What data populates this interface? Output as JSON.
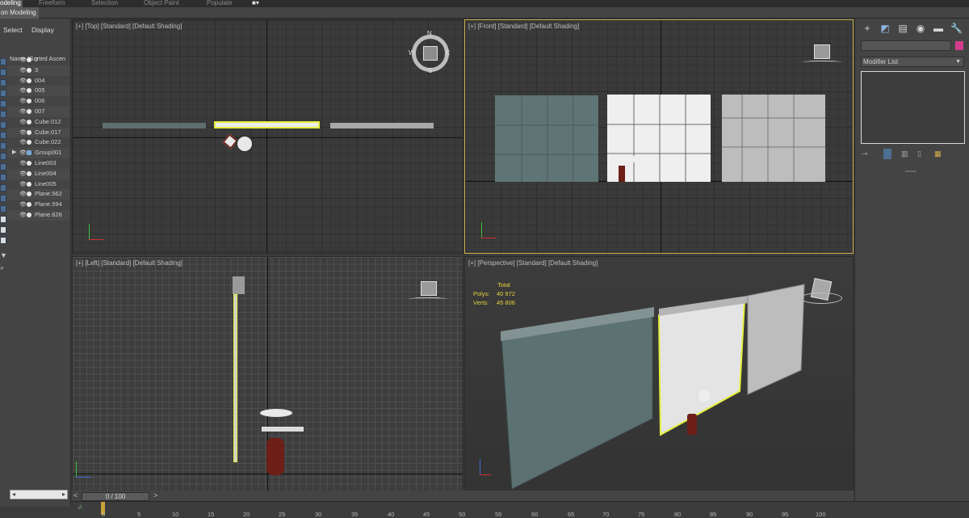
{
  "ribbon": {
    "tabs": [
      "odeling",
      "Freeform",
      "Selection",
      "Object Paint",
      "Populate"
    ],
    "sub_label": "on Modeling"
  },
  "explorer": {
    "select_label": "Select",
    "display_label": "Display",
    "column_header": "Name (Sorted Ascen",
    "items": [
      "2",
      "3",
      "004",
      "005",
      "006",
      "007",
      "Cube.012",
      "Cube.017",
      "Cube.022",
      "Group001",
      "Line003",
      "Line004",
      "Line005",
      "Plane.562",
      "Plane.594",
      "Plane.626"
    ]
  },
  "viewports": {
    "top": "[+] [Top] [Standard] [Default Shading]",
    "front": "[+] [Front] [Standard] [Default Shading]",
    "left": "[+] [Left] [Standard] [Default Shading]",
    "perspective": "[+] [Perspective] [Standard] [Default Shading]"
  },
  "viewcube": {
    "n": "N",
    "s": "S",
    "e": "E",
    "w": "W"
  },
  "stats": {
    "total_label": "Total",
    "polys_label": "Polys:",
    "polys_value": "40 972",
    "verts_label": "Verts:",
    "verts_value": "45 806"
  },
  "command_panel": {
    "modifier_list_label": "Modifier List",
    "object_color": "#d43d8c"
  },
  "timeline": {
    "slider_label": "0 / 100",
    "ticks": [
      "0",
      "5",
      "10",
      "15",
      "20",
      "25",
      "30",
      "35",
      "40",
      "45",
      "50",
      "55",
      "60",
      "65",
      "70",
      "75",
      "80",
      "85",
      "90",
      "95",
      "100"
    ],
    "current_frame": 0
  },
  "colors": {
    "selection_highlight": "#e4f03c",
    "active_viewport_border": "#c9b14a",
    "explorer_icon": "#4e6e91"
  }
}
